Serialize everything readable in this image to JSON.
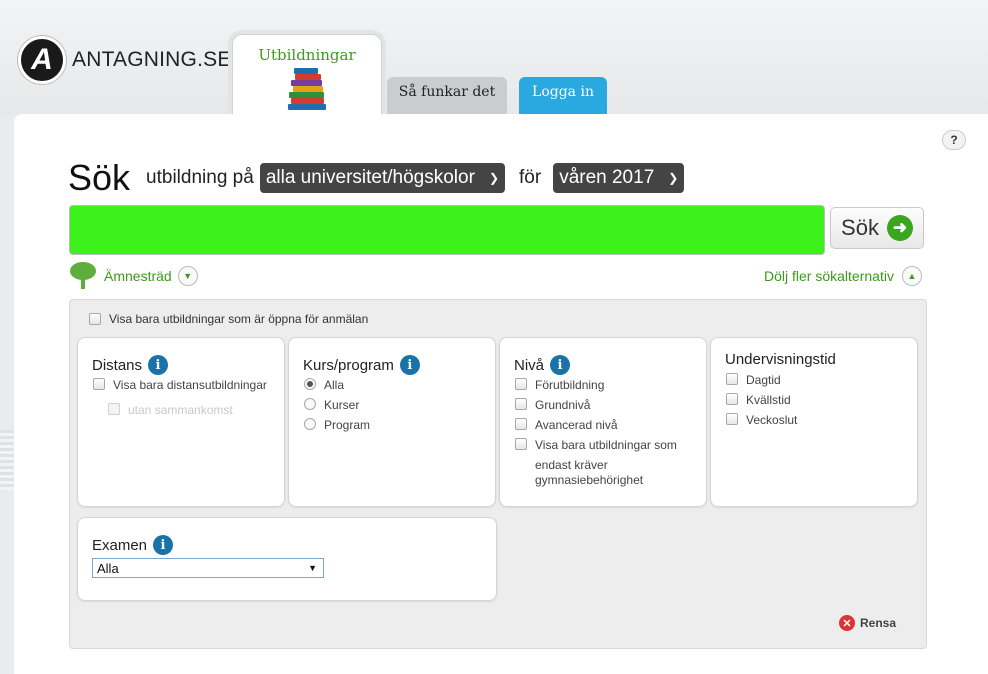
{
  "brand": {
    "logo_letter": "A",
    "name": "ANTAGNING.SE"
  },
  "tabs": [
    {
      "label": "Utbildningar"
    },
    {
      "label": "Så funkar det"
    },
    {
      "label": "Logga in"
    }
  ],
  "help": {
    "label": "?"
  },
  "search": {
    "title": "Sök",
    "prefix": "utbildning på",
    "school_select": "alla universitet/högskolor",
    "middle": "för",
    "term_select": "våren 2017",
    "button_label": "Sök"
  },
  "links": {
    "subject_tree": "Ämnesträd",
    "hide_options": "Dölj fler sökalternativ"
  },
  "filters": {
    "open_only": "Visa bara utbildningar som är öppna för anmälan",
    "distans": {
      "title": "Distans",
      "options": [
        "Visa bara distansutbildningar",
        "utan sammankomst"
      ]
    },
    "kurs_program": {
      "title": "Kurs/program",
      "options": [
        "Alla",
        "Kurser",
        "Program"
      ],
      "selected": "Alla"
    },
    "niva": {
      "title": "Nivå",
      "options": [
        "Förutbildning",
        "Grundnivå",
        "Avancerad nivå",
        "Visa bara utbildningar som",
        "endast kräver",
        "gymnasiebehörighet"
      ]
    },
    "undervisningstid": {
      "title": "Undervisningstid",
      "options": [
        "Dagtid",
        "Kvällstid",
        "Veckoslut"
      ]
    },
    "examen": {
      "title": "Examen",
      "selected": "Alla"
    }
  },
  "reset": {
    "label": "Rensa"
  },
  "colors": {
    "green": "#3c9a1e",
    "search_fill": "#3cf21a",
    "blue_tab": "#2aa8e0",
    "info": "#1a73a8"
  }
}
